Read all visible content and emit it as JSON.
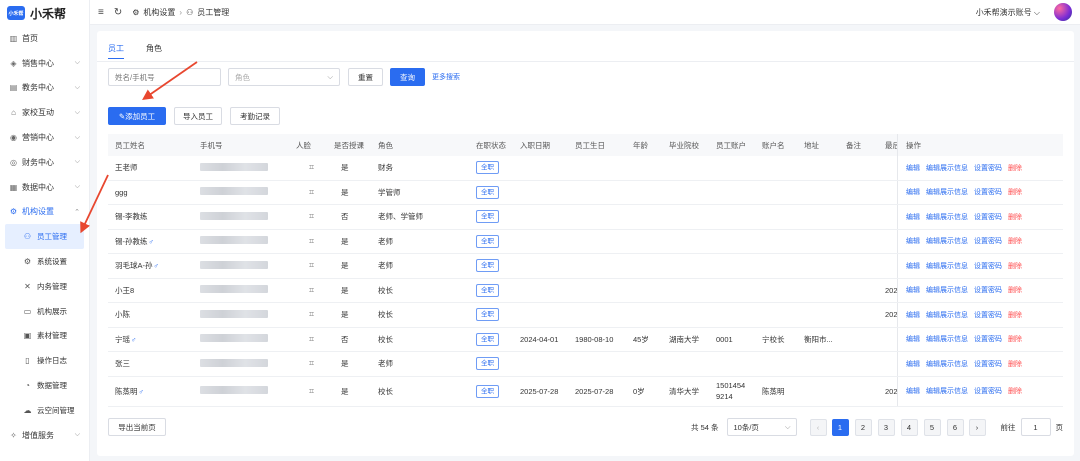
{
  "brand": {
    "logo": "小禾帮",
    "name": "小禾帮"
  },
  "sidebar": {
    "items": [
      {
        "label": "首页",
        "icon": "chart-bar-icon",
        "glyph": "▥",
        "chev": false
      },
      {
        "label": "销售中心",
        "icon": "layers-icon",
        "glyph": "◈",
        "chev": true
      },
      {
        "label": "教务中心",
        "icon": "book-icon",
        "glyph": "▤",
        "chev": true
      },
      {
        "label": "家校互动",
        "icon": "home-icon",
        "glyph": "⌂",
        "chev": true
      },
      {
        "label": "营销中心",
        "icon": "megaphone-icon",
        "glyph": "◉",
        "chev": true
      },
      {
        "label": "财务中心",
        "icon": "money-icon",
        "glyph": "◎",
        "chev": true
      },
      {
        "label": "数据中心",
        "icon": "stats-icon",
        "glyph": "▦",
        "chev": true
      },
      {
        "label": "机构设置",
        "icon": "gear-icon",
        "glyph": "⚙",
        "chev": true
      }
    ],
    "sub_items": [
      {
        "label": "员工管理",
        "icon": "user-group-icon",
        "glyph": "⚇"
      },
      {
        "label": "系统设置",
        "icon": "settings-icon",
        "glyph": "⚙"
      },
      {
        "label": "内务管理",
        "icon": "tools-icon",
        "glyph": "✕"
      },
      {
        "label": "机构展示",
        "icon": "document-icon",
        "glyph": "▭"
      },
      {
        "label": "素材管理",
        "icon": "folder-icon",
        "glyph": "▣"
      },
      {
        "label": "操作日志",
        "icon": "log-icon",
        "glyph": "▯"
      },
      {
        "label": "数据管理",
        "icon": "pie-icon",
        "glyph": "◔"
      },
      {
        "label": "云空间管理",
        "icon": "cloud-icon",
        "glyph": "☁"
      }
    ],
    "bottom_item": {
      "label": "增值服务",
      "icon": "gem-icon",
      "glyph": "✧"
    }
  },
  "topbar": {
    "breadcrumb": [
      "机构设置",
      "员工管理"
    ],
    "account": "小禾帮演示账号"
  },
  "tabs": [
    "员工",
    "角色"
  ],
  "filter": {
    "name_placeholder": "姓名/手机号",
    "role_placeholder": "角色",
    "reset": "重置",
    "search": "查询",
    "more": "更多搜索"
  },
  "actions": {
    "add": "添加员工",
    "import": "导入员工",
    "attendance": "考勤记录"
  },
  "table": {
    "headers": {
      "name": "员工姓名",
      "phone": "手机号",
      "face": "人脸",
      "teach": "是否授课",
      "role": "角色",
      "status": "在职状态",
      "join": "入职日期",
      "birth": "员工生日",
      "age": "年龄",
      "school": "毕业院校",
      "acct": "员工账户",
      "acctname": "账户名",
      "addr": "地址",
      "note": "备注",
      "last": "最后",
      "ops": "操作"
    },
    "ops": {
      "edit": "编辑",
      "edit_show": "编辑展示信息",
      "set_pwd": "设置密码",
      "delete": "删除"
    },
    "rows": [
      {
        "name": "王老师",
        "gender": "",
        "teach": "是",
        "role": "财务",
        "status": "全职",
        "join": "",
        "birth": "",
        "age": "",
        "school": "",
        "acct": "",
        "acct2": "",
        "acctname": "",
        "addr": "",
        "last": ""
      },
      {
        "name": "ggg",
        "gender": "",
        "teach": "是",
        "role": "学管师",
        "status": "全职",
        "join": "",
        "birth": "",
        "age": "",
        "school": "",
        "acct": "",
        "acct2": "",
        "acctname": "",
        "addr": "",
        "last": ""
      },
      {
        "name": "锡-李教练",
        "gender": "",
        "teach": "否",
        "role": "老师、学管师",
        "status": "全职",
        "join": "",
        "birth": "",
        "age": "",
        "school": "",
        "acct": "",
        "acct2": "",
        "acctname": "",
        "addr": "",
        "last": ""
      },
      {
        "name": "锡-孙教练",
        "gender": "♂",
        "teach": "是",
        "role": "老师",
        "status": "全职",
        "join": "",
        "birth": "",
        "age": "",
        "school": "",
        "acct": "",
        "acct2": "",
        "acctname": "",
        "addr": "",
        "last": ""
      },
      {
        "name": "羽毛球A-孙",
        "gender": "♂",
        "teach": "是",
        "role": "老师",
        "status": "全职",
        "join": "",
        "birth": "",
        "age": "",
        "school": "",
        "acct": "",
        "acct2": "",
        "acctname": "",
        "addr": "",
        "last": ""
      },
      {
        "name": "小王8",
        "gender": "",
        "teach": "是",
        "role": "校长",
        "status": "全职",
        "join": "",
        "birth": "",
        "age": "",
        "school": "",
        "acct": "",
        "acct2": "",
        "acctname": "",
        "addr": "",
        "last": "202"
      },
      {
        "name": "小陈",
        "gender": "",
        "teach": "是",
        "role": "校长",
        "status": "全职",
        "join": "",
        "birth": "",
        "age": "",
        "school": "",
        "acct": "",
        "acct2": "",
        "acctname": "",
        "addr": "",
        "last": "202"
      },
      {
        "name": "宁瑶",
        "gender": "♂",
        "teach": "否",
        "role": "校长",
        "status": "全职",
        "join": "2024-04-01",
        "birth": "1980-08-10",
        "age": "45岁",
        "school": "湖南大学",
        "acct": "0001",
        "acct2": "",
        "acctname": "宁校长",
        "addr": "衡阳市...",
        "last": ""
      },
      {
        "name": "张三",
        "gender": "",
        "teach": "是",
        "role": "老师",
        "status": "全职",
        "join": "",
        "birth": "",
        "age": "",
        "school": "",
        "acct": "",
        "acct2": "",
        "acctname": "",
        "addr": "",
        "last": ""
      },
      {
        "name": "陈蒸明",
        "gender": "♂",
        "teach": "是",
        "role": "校长",
        "status": "全职",
        "join": "2025-07-28",
        "birth": "2025-07-28",
        "age": "0岁",
        "school": "清华大学",
        "acct": "1501454",
        "acct2": "9214",
        "acctname": "陈蒸明",
        "addr": "",
        "last": "202"
      }
    ]
  },
  "footer": {
    "export": "导出当前页",
    "total": "共 54 条",
    "page_size": "10条/页",
    "pages": [
      "1",
      "2",
      "3",
      "4",
      "5",
      "6"
    ],
    "goto_label": "前往",
    "goto_value": "1",
    "page_unit": "页"
  },
  "colors": {
    "primary": "#2a6cf0",
    "danger": "#ff4d4f",
    "annotation": "#e8472f"
  }
}
